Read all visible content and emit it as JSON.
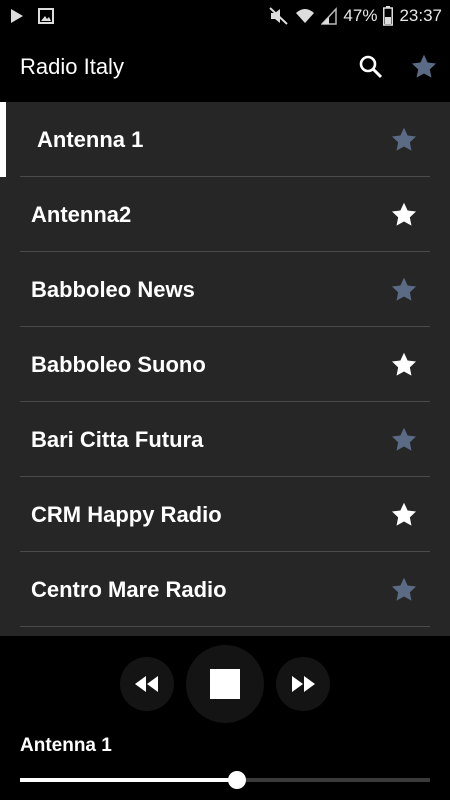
{
  "status_bar": {
    "battery": "47%",
    "time": "23:37"
  },
  "app_bar": {
    "title": "Radio Italy",
    "search_icon": "search-icon",
    "favorites_icon": "star-icon"
  },
  "stations": [
    {
      "name": "Antenna 1",
      "favorite": false,
      "selected": true
    },
    {
      "name": "Antenna2",
      "favorite": true,
      "selected": false
    },
    {
      "name": "Babboleo News",
      "favorite": false,
      "selected": false
    },
    {
      "name": "Babboleo Suono",
      "favorite": true,
      "selected": false
    },
    {
      "name": "Bari Citta Futura",
      "favorite": false,
      "selected": false
    },
    {
      "name": "CRM Happy Radio",
      "favorite": true,
      "selected": false
    },
    {
      "name": "Centro Mare Radio",
      "favorite": false,
      "selected": false
    }
  ],
  "player": {
    "now_playing": "Antenna 1",
    "progress": 0.53
  },
  "colors": {
    "star_favorite": "#ffffff",
    "star_default": "#5b6b85",
    "list_bg": "#262626"
  }
}
